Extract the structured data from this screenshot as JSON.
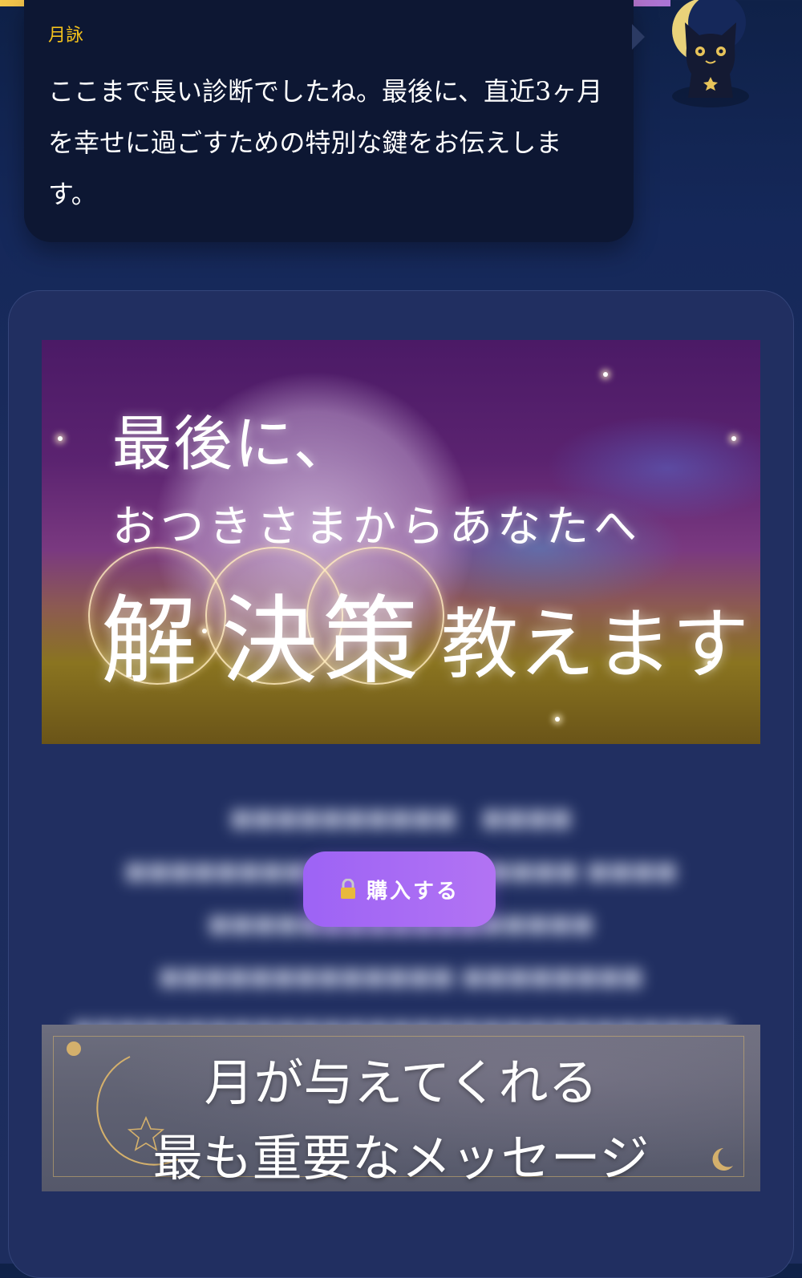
{
  "chat": {
    "speaker": "月詠",
    "message": "ここまで長い診断でしたね。最後に、直近3ヶ月を幸せに過ごすための特別な鍵をお伝えします。"
  },
  "banner_solution": {
    "line1": "最後に、",
    "line2": "おつきさまからあなたへ",
    "highlight": [
      "解",
      "決",
      "策"
    ],
    "tail": "教えます"
  },
  "paywall": {
    "buy_label": "購入する",
    "icon": "lock-icon"
  },
  "banner_message": {
    "line1": "月が与えてくれる",
    "line2": "最も重要なメッセージ"
  },
  "colors": {
    "speaker": "#f4c21c",
    "button_start": "#9d63f5",
    "button_end": "#b273f3",
    "card": "#212f61",
    "bubble": "#0d1733"
  }
}
